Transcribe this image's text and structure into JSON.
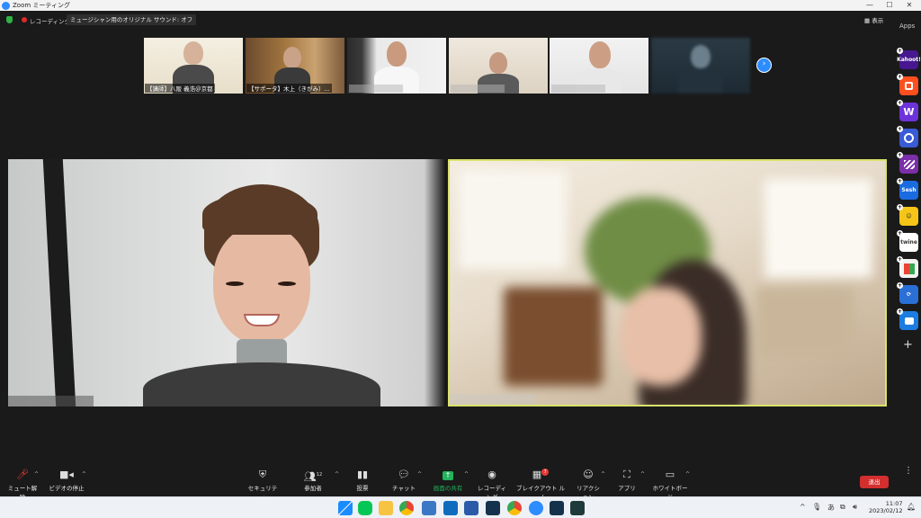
{
  "window": {
    "title": "Zoom ミーティング",
    "minimize": "—",
    "maximize": "☐",
    "close": "✕"
  },
  "status": {
    "recording_label": "レコーディング",
    "original_sound_label": "ミュージシャン用のオリジナル サウンド: オフ",
    "view_label": "表示"
  },
  "apps_panel": {
    "title": "Apps",
    "items": [
      {
        "icon": "kahoot-icon",
        "label": "Kahoot!",
        "color": "#46178f"
      },
      {
        "icon": "app-orange-icon",
        "label": "",
        "color": "#ff4f1f"
      },
      {
        "icon": "wordly-icon",
        "label": "W",
        "color": "#6d32d9"
      },
      {
        "icon": "app-blue-circle-icon",
        "label": "",
        "color": "#3a5bd6"
      },
      {
        "icon": "app-stripes-icon",
        "label": "",
        "color": "#7b2fa8"
      },
      {
        "icon": "sesh-icon",
        "label": "Sesh",
        "color": "#1a6be0"
      },
      {
        "icon": "app-yellow-face-icon",
        "label": "",
        "color": "#f5c518"
      },
      {
        "icon": "twine-icon",
        "label": "twine",
        "color": "#ffffff"
      },
      {
        "icon": "app-colorblocks-icon",
        "label": "",
        "color": "#f2f2f2"
      },
      {
        "icon": "app-sync-icon",
        "label": "",
        "color": "#2a6fd6"
      },
      {
        "icon": "app-blue-square-icon",
        "label": "",
        "color": "#1c7ce0"
      }
    ],
    "add_label": "+"
  },
  "thumbnails": [
    {
      "name": "【講師】八阪 義浩＠京都"
    },
    {
      "name": "【サポータ】木上（きがみ）..."
    },
    {
      "name": ""
    },
    {
      "name": ""
    },
    {
      "name": ""
    },
    {
      "name": ""
    }
  ],
  "next_button": "›",
  "toolbar": {
    "unmute": "ミュート解除",
    "stop_video": "ビデオの停止",
    "security": "セキュリティ",
    "participants": "参加者",
    "participants_count": "12",
    "polls": "投票",
    "chat": "チャット",
    "share_screen": "画面の共有",
    "record": "レコーディング",
    "breakout": "ブレイクアウト ルーム",
    "breakout_badge": "7",
    "reactions": "リアクション",
    "apps": "アプリ",
    "whiteboard": "ホワイトボード",
    "leave": "退出",
    "more": "⋮"
  },
  "taskbar": {
    "time": "11:07",
    "date": "2023/02/12",
    "ime": "あ",
    "chevron": "^"
  },
  "colors": {
    "zoom_blue": "#2d8cff",
    "active_speaker_border": "#d9e36b",
    "leave_red": "#d32f2f",
    "share_green": "#23b35c"
  }
}
